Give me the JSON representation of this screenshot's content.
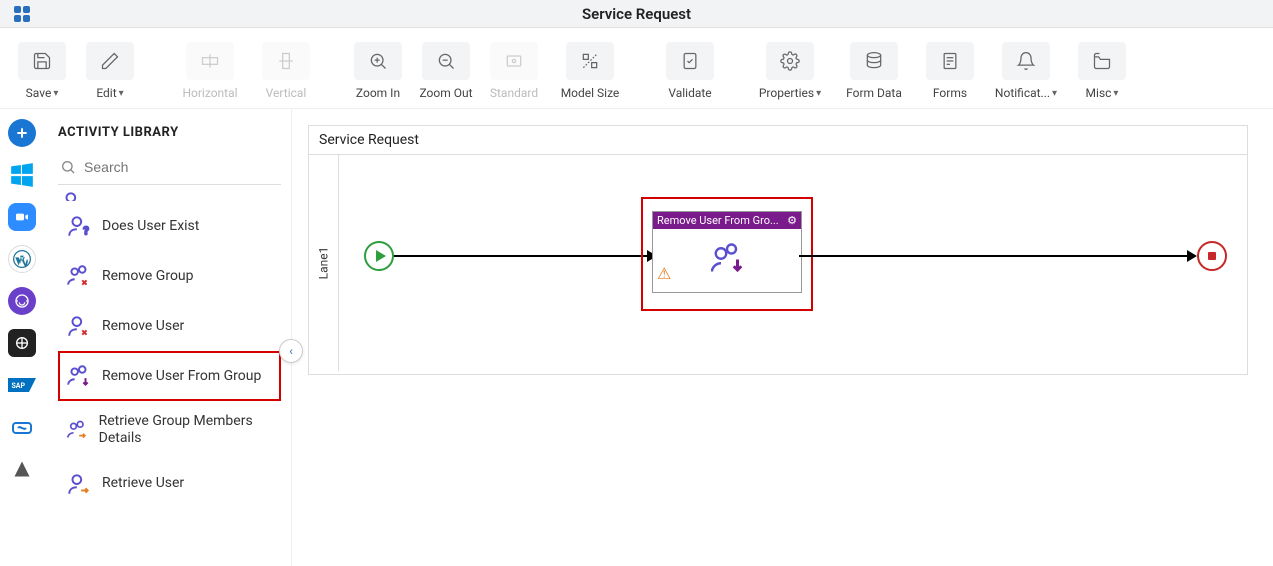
{
  "header": {
    "title": "Service Request"
  },
  "toolbar": {
    "save": "Save",
    "edit": "Edit",
    "horizontal": "Horizontal",
    "vertical": "Vertical",
    "zoom_in": "Zoom In",
    "zoom_out": "Zoom Out",
    "standard": "Standard",
    "model_size": "Model Size",
    "validate": "Validate",
    "properties": "Properties",
    "form_data": "Form Data",
    "forms": "Forms",
    "notifications": "Notificat...",
    "misc": "Misc"
  },
  "panel": {
    "title": "ACTIVITY LIBRARY",
    "search_placeholder": "Search",
    "items": [
      {
        "label": "Does User Exist",
        "icon": "user-question",
        "selected": false
      },
      {
        "label": "Remove Group",
        "icon": "group-x",
        "selected": false
      },
      {
        "label": "Remove User",
        "icon": "user-x",
        "selected": false
      },
      {
        "label": "Remove User From Group",
        "icon": "group-down",
        "selected": true
      },
      {
        "label": "Retrieve Group Members Details",
        "icon": "group-arrow",
        "selected": false
      },
      {
        "label": "Retrieve User",
        "icon": "user-arrow",
        "selected": false
      }
    ]
  },
  "canvas": {
    "title": "Service Request",
    "lane": "Lane1",
    "node_title": "Remove User From Gro..."
  },
  "colors": {
    "accent": "#2a6fbb",
    "brand_purple": "#7a1b8b",
    "start_green": "#2e9e3f",
    "end_red": "#c62828",
    "highlight_red": "#d40000"
  }
}
